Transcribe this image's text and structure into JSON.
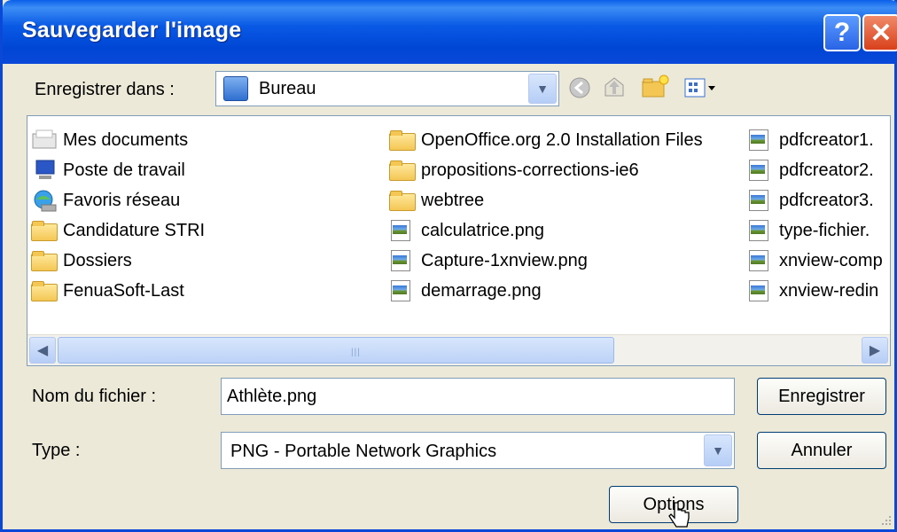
{
  "window": {
    "title": "Sauvegarder l'image"
  },
  "save_in": {
    "label": "Enregistrer dans :",
    "value": "Bureau"
  },
  "files": {
    "column1": [
      {
        "name": "Mes documents",
        "icon": "my-documents-icon"
      },
      {
        "name": "Poste de travail",
        "icon": "my-computer-icon"
      },
      {
        "name": "Favoris réseau",
        "icon": "network-places-icon"
      },
      {
        "name": "Candidature STRI",
        "icon": "folder-icon"
      },
      {
        "name": "Dossiers",
        "icon": "folder-icon"
      },
      {
        "name": "FenuaSoft-Last",
        "icon": "folder-icon"
      }
    ],
    "column2": [
      {
        "name": "OpenOffice.org 2.0 Installation Files",
        "icon": "folder-icon"
      },
      {
        "name": "propositions-corrections-ie6",
        "icon": "folder-icon"
      },
      {
        "name": "webtree",
        "icon": "folder-icon"
      },
      {
        "name": "calculatrice.png",
        "icon": "image-file-icon"
      },
      {
        "name": "Capture-1xnview.png",
        "icon": "image-file-icon"
      },
      {
        "name": "demarrage.png",
        "icon": "image-file-icon"
      }
    ],
    "column3": [
      {
        "name": "pdfcreator1.",
        "icon": "image-file-icon"
      },
      {
        "name": "pdfcreator2.",
        "icon": "image-file-icon"
      },
      {
        "name": "pdfcreator3.",
        "icon": "image-file-icon"
      },
      {
        "name": "type-fichier.",
        "icon": "image-file-icon"
      },
      {
        "name": "xnview-comp",
        "icon": "image-file-icon"
      },
      {
        "name": "xnview-redin",
        "icon": "image-file-icon"
      }
    ]
  },
  "filename": {
    "label": "Nom du fichier :",
    "value": "Athlète.png"
  },
  "type": {
    "label": "Type :",
    "value": "PNG - Portable Network Graphics"
  },
  "buttons": {
    "save": "Enregistrer",
    "cancel": "Annuler",
    "options": "Options"
  }
}
